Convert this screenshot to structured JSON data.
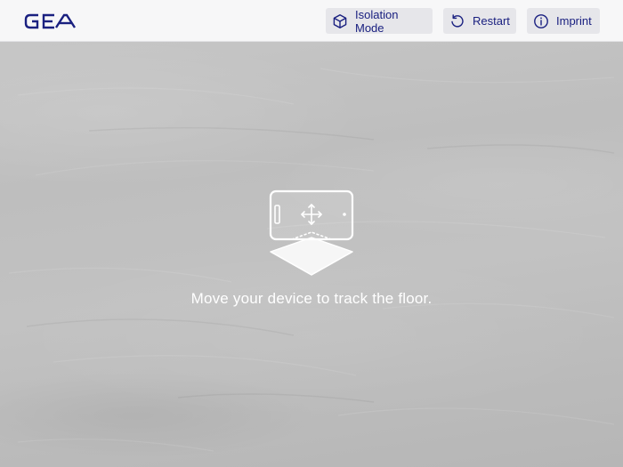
{
  "header": {
    "logo_text": "GEA",
    "buttons": [
      {
        "label": "Isolation Mode",
        "icon": "cube-icon"
      },
      {
        "label": "Restart",
        "icon": "restart-icon"
      },
      {
        "label": "Imprint",
        "icon": "info-icon"
      }
    ]
  },
  "main": {
    "hint": "Move your device to track the floor.",
    "illustration": "phone-floor-tracking-icon"
  },
  "colors": {
    "accent": "#1a2080",
    "header_bg": "#f7f7f8",
    "button_bg": "#e6e6ea",
    "hint_text": "#ffffff"
  }
}
